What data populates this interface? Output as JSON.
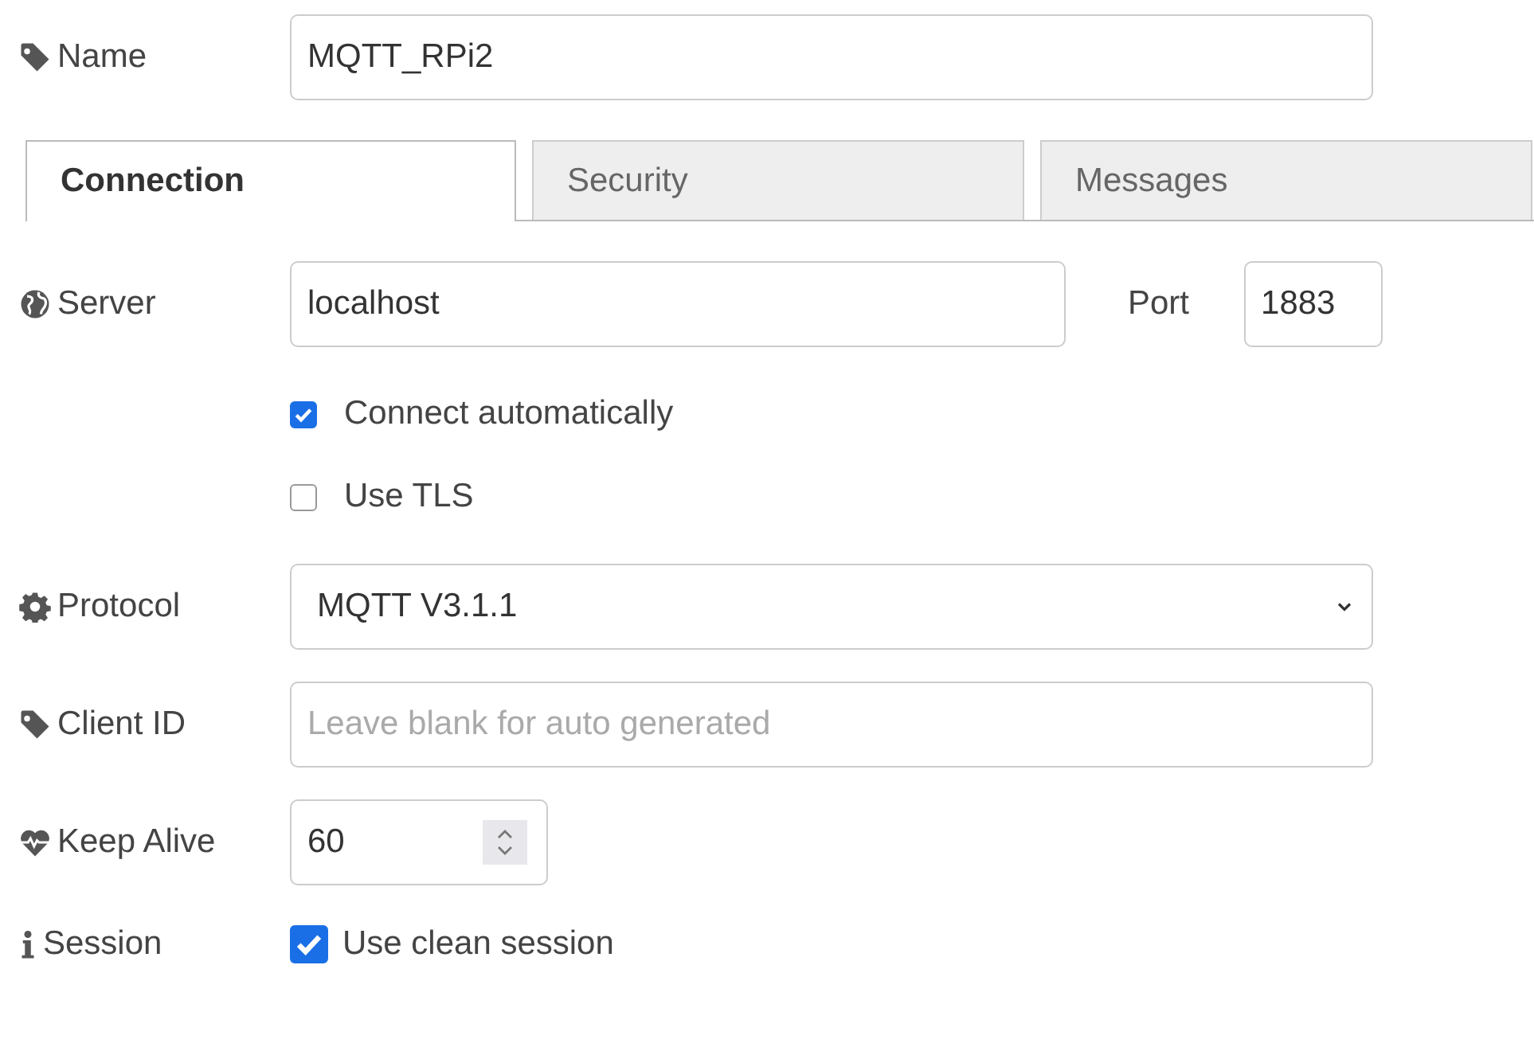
{
  "name": {
    "label": "Name",
    "value": "MQTT_RPi2"
  },
  "tabs": [
    {
      "label": "Connection",
      "selected": true
    },
    {
      "label": "Security",
      "selected": false
    },
    {
      "label": "Messages",
      "selected": false
    }
  ],
  "server": {
    "label": "Server",
    "value": "localhost",
    "port_label": "Port",
    "port": "1883"
  },
  "options": [
    {
      "label": "Connect automatically",
      "checked": true
    },
    {
      "label": "Use TLS",
      "checked": false
    }
  ],
  "protocol": {
    "label": "Protocol",
    "value": "MQTT V3.1.1"
  },
  "client_id": {
    "label": "Client ID",
    "placeholder": "Leave blank for auto generated"
  },
  "keep_alive": {
    "label": "Keep Alive",
    "value": "60"
  },
  "session": {
    "label": "Session",
    "option": "Use clean session",
    "checked": true
  }
}
